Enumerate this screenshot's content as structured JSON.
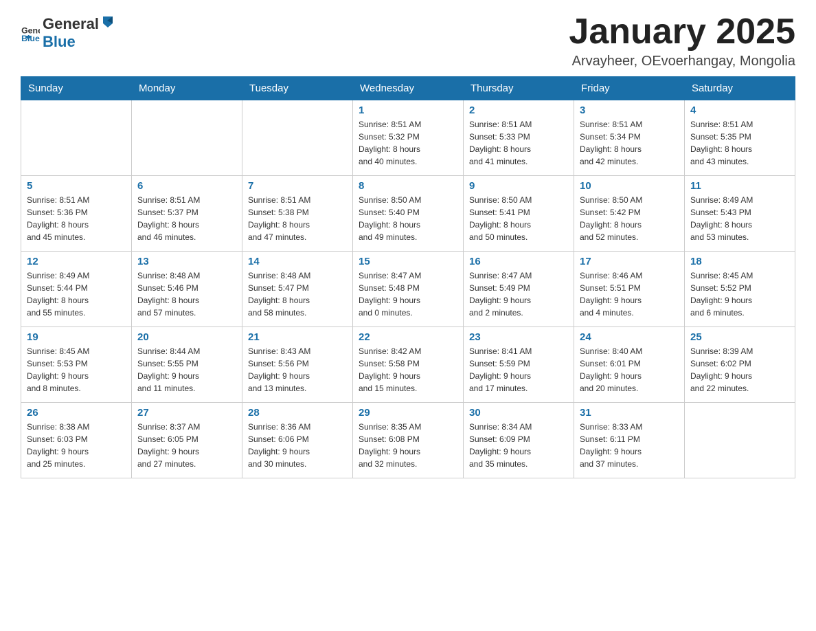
{
  "header": {
    "logo": {
      "general": "General",
      "blue": "Blue"
    },
    "title": "January 2025",
    "subtitle": "Arvayheer, OEvoerhangay, Mongolia"
  },
  "days_of_week": [
    "Sunday",
    "Monday",
    "Tuesday",
    "Wednesday",
    "Thursday",
    "Friday",
    "Saturday"
  ],
  "weeks": [
    [
      {
        "day": "",
        "info": ""
      },
      {
        "day": "",
        "info": ""
      },
      {
        "day": "",
        "info": ""
      },
      {
        "day": "1",
        "info": "Sunrise: 8:51 AM\nSunset: 5:32 PM\nDaylight: 8 hours\nand 40 minutes."
      },
      {
        "day": "2",
        "info": "Sunrise: 8:51 AM\nSunset: 5:33 PM\nDaylight: 8 hours\nand 41 minutes."
      },
      {
        "day": "3",
        "info": "Sunrise: 8:51 AM\nSunset: 5:34 PM\nDaylight: 8 hours\nand 42 minutes."
      },
      {
        "day": "4",
        "info": "Sunrise: 8:51 AM\nSunset: 5:35 PM\nDaylight: 8 hours\nand 43 minutes."
      }
    ],
    [
      {
        "day": "5",
        "info": "Sunrise: 8:51 AM\nSunset: 5:36 PM\nDaylight: 8 hours\nand 45 minutes."
      },
      {
        "day": "6",
        "info": "Sunrise: 8:51 AM\nSunset: 5:37 PM\nDaylight: 8 hours\nand 46 minutes."
      },
      {
        "day": "7",
        "info": "Sunrise: 8:51 AM\nSunset: 5:38 PM\nDaylight: 8 hours\nand 47 minutes."
      },
      {
        "day": "8",
        "info": "Sunrise: 8:50 AM\nSunset: 5:40 PM\nDaylight: 8 hours\nand 49 minutes."
      },
      {
        "day": "9",
        "info": "Sunrise: 8:50 AM\nSunset: 5:41 PM\nDaylight: 8 hours\nand 50 minutes."
      },
      {
        "day": "10",
        "info": "Sunrise: 8:50 AM\nSunset: 5:42 PM\nDaylight: 8 hours\nand 52 minutes."
      },
      {
        "day": "11",
        "info": "Sunrise: 8:49 AM\nSunset: 5:43 PM\nDaylight: 8 hours\nand 53 minutes."
      }
    ],
    [
      {
        "day": "12",
        "info": "Sunrise: 8:49 AM\nSunset: 5:44 PM\nDaylight: 8 hours\nand 55 minutes."
      },
      {
        "day": "13",
        "info": "Sunrise: 8:48 AM\nSunset: 5:46 PM\nDaylight: 8 hours\nand 57 minutes."
      },
      {
        "day": "14",
        "info": "Sunrise: 8:48 AM\nSunset: 5:47 PM\nDaylight: 8 hours\nand 58 minutes."
      },
      {
        "day": "15",
        "info": "Sunrise: 8:47 AM\nSunset: 5:48 PM\nDaylight: 9 hours\nand 0 minutes."
      },
      {
        "day": "16",
        "info": "Sunrise: 8:47 AM\nSunset: 5:49 PM\nDaylight: 9 hours\nand 2 minutes."
      },
      {
        "day": "17",
        "info": "Sunrise: 8:46 AM\nSunset: 5:51 PM\nDaylight: 9 hours\nand 4 minutes."
      },
      {
        "day": "18",
        "info": "Sunrise: 8:45 AM\nSunset: 5:52 PM\nDaylight: 9 hours\nand 6 minutes."
      }
    ],
    [
      {
        "day": "19",
        "info": "Sunrise: 8:45 AM\nSunset: 5:53 PM\nDaylight: 9 hours\nand 8 minutes."
      },
      {
        "day": "20",
        "info": "Sunrise: 8:44 AM\nSunset: 5:55 PM\nDaylight: 9 hours\nand 11 minutes."
      },
      {
        "day": "21",
        "info": "Sunrise: 8:43 AM\nSunset: 5:56 PM\nDaylight: 9 hours\nand 13 minutes."
      },
      {
        "day": "22",
        "info": "Sunrise: 8:42 AM\nSunset: 5:58 PM\nDaylight: 9 hours\nand 15 minutes."
      },
      {
        "day": "23",
        "info": "Sunrise: 8:41 AM\nSunset: 5:59 PM\nDaylight: 9 hours\nand 17 minutes."
      },
      {
        "day": "24",
        "info": "Sunrise: 8:40 AM\nSunset: 6:01 PM\nDaylight: 9 hours\nand 20 minutes."
      },
      {
        "day": "25",
        "info": "Sunrise: 8:39 AM\nSunset: 6:02 PM\nDaylight: 9 hours\nand 22 minutes."
      }
    ],
    [
      {
        "day": "26",
        "info": "Sunrise: 8:38 AM\nSunset: 6:03 PM\nDaylight: 9 hours\nand 25 minutes."
      },
      {
        "day": "27",
        "info": "Sunrise: 8:37 AM\nSunset: 6:05 PM\nDaylight: 9 hours\nand 27 minutes."
      },
      {
        "day": "28",
        "info": "Sunrise: 8:36 AM\nSunset: 6:06 PM\nDaylight: 9 hours\nand 30 minutes."
      },
      {
        "day": "29",
        "info": "Sunrise: 8:35 AM\nSunset: 6:08 PM\nDaylight: 9 hours\nand 32 minutes."
      },
      {
        "day": "30",
        "info": "Sunrise: 8:34 AM\nSunset: 6:09 PM\nDaylight: 9 hours\nand 35 minutes."
      },
      {
        "day": "31",
        "info": "Sunrise: 8:33 AM\nSunset: 6:11 PM\nDaylight: 9 hours\nand 37 minutes."
      },
      {
        "day": "",
        "info": ""
      }
    ]
  ]
}
